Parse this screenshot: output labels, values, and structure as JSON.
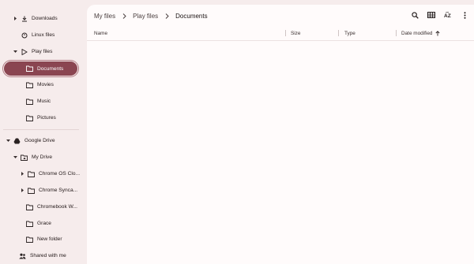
{
  "sidebar": {
    "items": [
      {
        "label": "Downloads",
        "icon": "download-icon",
        "expander": "right"
      },
      {
        "label": "Linux files",
        "icon": "linux-penguin-icon",
        "expander": ""
      },
      {
        "label": "Play files",
        "icon": "play-icon",
        "expander": "down"
      },
      {
        "label": "Documents",
        "icon": "folder-icon",
        "expander": ""
      },
      {
        "label": "Movies",
        "icon": "folder-icon",
        "expander": ""
      },
      {
        "label": "Music",
        "icon": "folder-icon",
        "expander": ""
      },
      {
        "label": "Pictures",
        "icon": "folder-icon",
        "expander": ""
      },
      {
        "label": "Google Drive",
        "icon": "google-drive-icon",
        "expander": "down"
      },
      {
        "label": "My Drive",
        "icon": "drive-folder-icon",
        "expander": "down"
      },
      {
        "label": "Chrome OS Clo...",
        "icon": "folder-icon",
        "expander": "right"
      },
      {
        "label": "Chrome Synca...",
        "icon": "folder-icon",
        "expander": "right"
      },
      {
        "label": "Chromebook W...",
        "icon": "folder-icon",
        "expander": ""
      },
      {
        "label": "Grace",
        "icon": "folder-icon",
        "expander": ""
      },
      {
        "label": "New folder",
        "icon": "folder-icon",
        "expander": ""
      },
      {
        "label": "Shared with me",
        "icon": "people-icon",
        "expander": ""
      }
    ],
    "selected": "Documents"
  },
  "breadcrumb": {
    "items": [
      "My files",
      "Play files",
      "Documents"
    ]
  },
  "toolbar": {
    "search_icon": "search-icon",
    "view_icon": "grid-view-icon",
    "sort_icon": "sort-az-icon",
    "more_icon": "more-vert-icon"
  },
  "columns": {
    "name": "Name",
    "size": "Size",
    "type": "Type",
    "date_modified": "Date modified",
    "sort_indicator": "sort-ascending-arrow-icon"
  },
  "colors": {
    "selected_bg": "#8a4551",
    "sidebar_bg": "#f6ecec",
    "main_bg": "#fffbfb"
  }
}
